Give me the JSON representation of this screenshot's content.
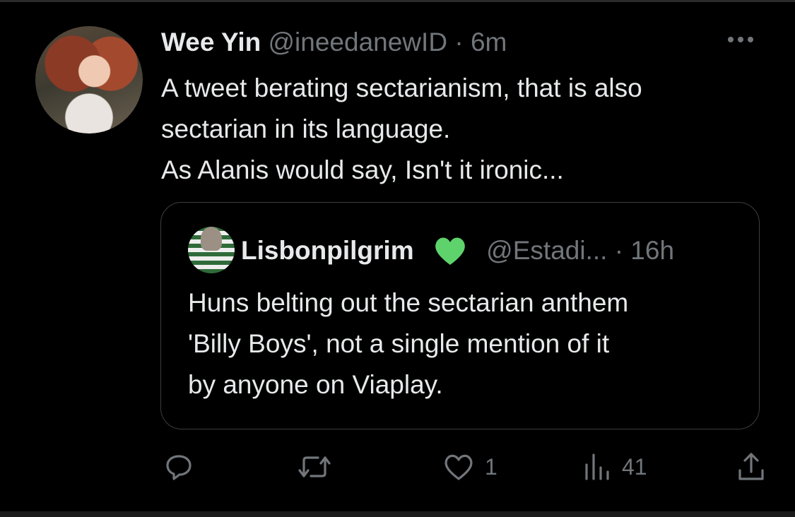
{
  "tweet": {
    "author_name": "Wee Yin",
    "author_handle": "@ineedanewID",
    "separator": "·",
    "time": "6m",
    "text_lines": [
      "A tweet berating sectarianism, that is also",
      "sectarian in its language.",
      "As Alanis would say, Isn't it ironic..."
    ]
  },
  "quoted": {
    "author_name": "Lisbonpilgrim",
    "badge_icon": "green-heart-icon",
    "author_handle": "@Estadi...",
    "separator": "·",
    "time": "16h",
    "text_lines": [
      "Huns belting out the sectarian anthem",
      "'Billy Boys', not a single mention of it",
      "by anyone on Viaplay."
    ]
  },
  "actions": {
    "reply_icon": "reply-icon",
    "retweet_icon": "retweet-icon",
    "like_icon": "heart-icon",
    "like_count": "1",
    "views_icon": "views-icon",
    "view_count": "41",
    "share_icon": "share-icon"
  },
  "colors": {
    "background": "#000000",
    "text": "#e7e9ea",
    "muted": "#71767b",
    "heart_green": "#5fd36b",
    "border": "#3a3d41"
  }
}
